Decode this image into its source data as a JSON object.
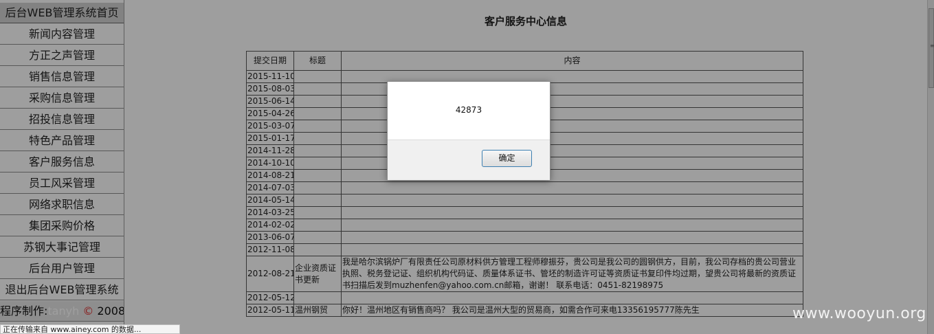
{
  "sidebar": {
    "items": [
      {
        "label": "后台WEB管理系统首页"
      },
      {
        "label": "新闻内容管理"
      },
      {
        "label": "方正之声管理"
      },
      {
        "label": "销售信息管理"
      },
      {
        "label": "采购信息管理"
      },
      {
        "label": "招投信息管理"
      },
      {
        "label": "特色产品管理"
      },
      {
        "label": "客户服务信息"
      },
      {
        "label": "员工风采管理"
      },
      {
        "label": "网络求职信息"
      },
      {
        "label": "集团采购价格"
      },
      {
        "label": "苏钢大事记管理"
      },
      {
        "label": "后台用户管理"
      },
      {
        "label": "退出后台WEB管理系统"
      }
    ],
    "footer": {
      "prefix": "程序制作:",
      "author": "tanyh",
      "copyright": "©",
      "year": "2008"
    }
  },
  "main": {
    "title": "客户服务中心信息",
    "table": {
      "headers": {
        "date": "提交日期",
        "title": "标题",
        "content": "内容"
      },
      "rows": [
        {
          "date": "2015-11-10",
          "title": "",
          "content": ""
        },
        {
          "date": "2015-08-03",
          "title": "",
          "content": ""
        },
        {
          "date": "2015-06-14",
          "title": "",
          "content": ""
        },
        {
          "date": "2015-04-26",
          "title": "",
          "content": ""
        },
        {
          "date": "2015-03-07",
          "title": "",
          "content": ""
        },
        {
          "date": "2015-01-17",
          "title": "",
          "content": ""
        },
        {
          "date": "2014-11-28",
          "title": "",
          "content": ""
        },
        {
          "date": "2014-10-10",
          "title": "",
          "content": ""
        },
        {
          "date": "2014-08-21",
          "title": "",
          "content": ""
        },
        {
          "date": "2014-07-03",
          "title": "",
          "content": ""
        },
        {
          "date": "2014-05-14",
          "title": "",
          "content": ""
        },
        {
          "date": "2014-03-25",
          "title": "",
          "content": ""
        },
        {
          "date": "2014-02-02",
          "title": "",
          "content": ""
        },
        {
          "date": "2013-06-07",
          "title": "",
          "content": ""
        },
        {
          "date": "2012-11-08",
          "title": "",
          "content": ""
        },
        {
          "date": "2012-08-21",
          "title": "企业资质证书更新",
          "content": "我是哈尔滨锅炉厂有限责任公司原材料供方管理工程师穆振芬，贵公司是我公司的圆钢供方，目前，我公司存档的贵公司营业执照、税务登记证、组织机构代码证、质量体系证书、管坯的制造许可证等资质证书复印件均过期，望贵公司将最新的资质证书扫描后发到muzhenfen@yahoo.com.cn邮箱，谢谢！ 联系电话：0451-82198975"
        },
        {
          "date": "2012-05-12",
          "title": "",
          "content": ""
        },
        {
          "date": "2012-05-11",
          "title": "温州钢贸",
          "content": "你好！温州地区有销售商吗？ 我公司是温州大型的贸易商，如需合作可来电13356195777陈先生"
        }
      ]
    }
  },
  "dialog": {
    "message": "42873",
    "ok_label": "确定"
  },
  "status_bar": {
    "text": "正在传输来自 www.ainey.com 的数据..."
  },
  "watermark": {
    "text": "www.wooyun.org"
  }
}
